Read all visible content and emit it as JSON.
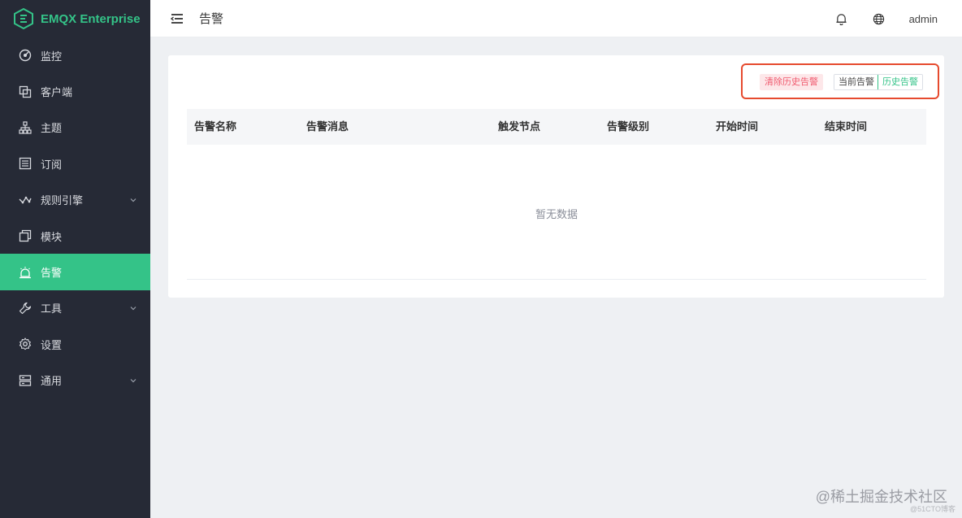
{
  "brand": {
    "name": "EMQX Enterprise",
    "color": "#34c388"
  },
  "sidebar": {
    "items": [
      {
        "label": "监控",
        "icon": "dashboard-icon",
        "expandable": false,
        "active": false
      },
      {
        "label": "客户端",
        "icon": "clients-icon",
        "expandable": false,
        "active": false
      },
      {
        "label": "主题",
        "icon": "topic-tree-icon",
        "expandable": false,
        "active": false
      },
      {
        "label": "订阅",
        "icon": "subscription-list-icon",
        "expandable": false,
        "active": false
      },
      {
        "label": "规则引擎",
        "icon": "rule-engine-icon",
        "expandable": true,
        "active": false
      },
      {
        "label": "模块",
        "icon": "modules-icon",
        "expandable": false,
        "active": false
      },
      {
        "label": "告警",
        "icon": "alarm-icon",
        "expandable": false,
        "active": true
      },
      {
        "label": "工具",
        "icon": "wrench-icon",
        "expandable": true,
        "active": false
      },
      {
        "label": "设置",
        "icon": "gear-icon",
        "expandable": false,
        "active": false
      },
      {
        "label": "通用",
        "icon": "general-icon",
        "expandable": true,
        "active": false
      }
    ]
  },
  "header": {
    "title": "告警",
    "user": "admin",
    "icons": [
      "menu-toggle-icon",
      "bell-icon",
      "globe-icon"
    ]
  },
  "toolbar": {
    "clear_label": "清除历史告警",
    "tabs": [
      {
        "label": "当前告警",
        "active": false
      },
      {
        "label": "历史告警",
        "active": true
      }
    ]
  },
  "table": {
    "columns": [
      "告警名称",
      "告警消息",
      "触发节点",
      "告警级别",
      "开始时间",
      "结束时间"
    ],
    "rows": [],
    "empty_text": "暂无数据"
  },
  "watermark": {
    "text": "@稀土掘金技术社区",
    "sub": "@51CTO博客"
  }
}
